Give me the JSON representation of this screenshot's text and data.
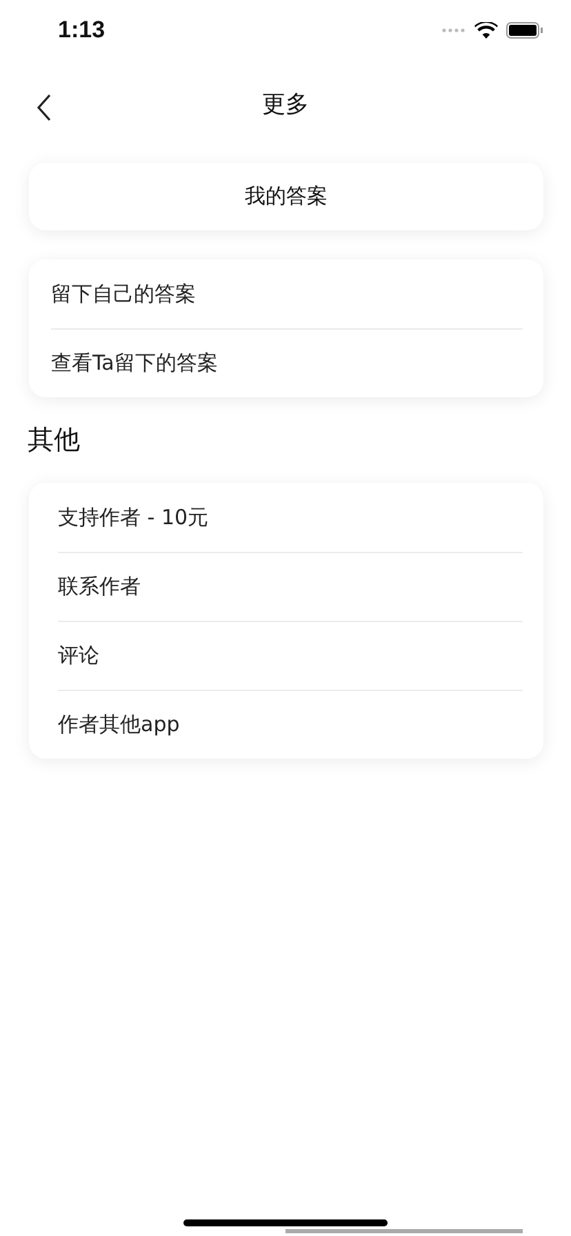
{
  "status_bar": {
    "time": "1:13"
  },
  "nav": {
    "title": "更多"
  },
  "primary_button": {
    "label": "我的答案"
  },
  "answer_items": [
    {
      "label": "留下自己的答案"
    },
    {
      "label": "查看Ta留下的答案"
    }
  ],
  "section_title": "其他",
  "other_items": [
    {
      "label": "支持作者 - 10元"
    },
    {
      "label": "联系作者"
    },
    {
      "label": "评论"
    },
    {
      "label": "作者其他app"
    }
  ]
}
